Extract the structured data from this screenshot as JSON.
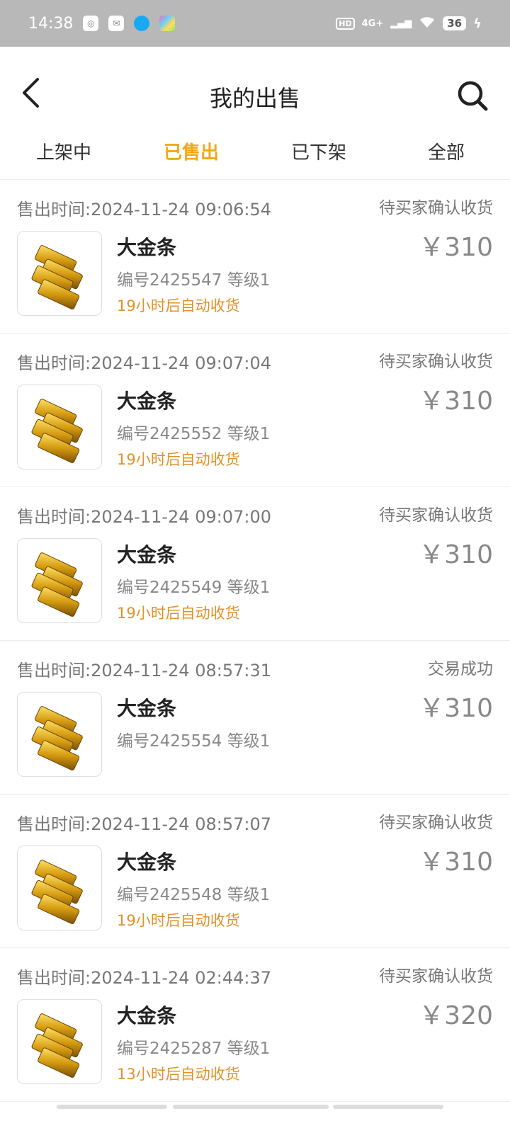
{
  "status_bar": {
    "time": "14:38",
    "hd": "HD",
    "network": "4G+",
    "battery": "36"
  },
  "header": {
    "title": "我的出售"
  },
  "tabs": [
    {
      "label": "上架中",
      "active": false
    },
    {
      "label": "已售出",
      "active": true
    },
    {
      "label": "已下架",
      "active": false
    },
    {
      "label": "全部",
      "active": false
    }
  ],
  "items": [
    {
      "time": "售出时间:2024-11-24 09:06:54",
      "status": "待买家确认收货",
      "name": "大金条",
      "meta": "编号2425547 等级1",
      "note": "19小时后自动收货",
      "price": "￥310"
    },
    {
      "time": "售出时间:2024-11-24 09:07:04",
      "status": "待买家确认收货",
      "name": "大金条",
      "meta": "编号2425552 等级1",
      "note": "19小时后自动收货",
      "price": "￥310"
    },
    {
      "time": "售出时间:2024-11-24 09:07:00",
      "status": "待买家确认收货",
      "name": "大金条",
      "meta": "编号2425549 等级1",
      "note": "19小时后自动收货",
      "price": "￥310"
    },
    {
      "time": "售出时间:2024-11-24 08:57:31",
      "status": "交易成功",
      "name": "大金条",
      "meta": "编号2425554 等级1",
      "note": "",
      "price": "￥310"
    },
    {
      "time": "售出时间:2024-11-24 08:57:07",
      "status": "待买家确认收货",
      "name": "大金条",
      "meta": "编号2425548 等级1",
      "note": "19小时后自动收货",
      "price": "￥310"
    },
    {
      "time": "售出时间:2024-11-24 02:44:37",
      "status": "待买家确认收货",
      "name": "大金条",
      "meta": "编号2425287 等级1",
      "note": "13小时后自动收货",
      "price": "￥320"
    }
  ]
}
